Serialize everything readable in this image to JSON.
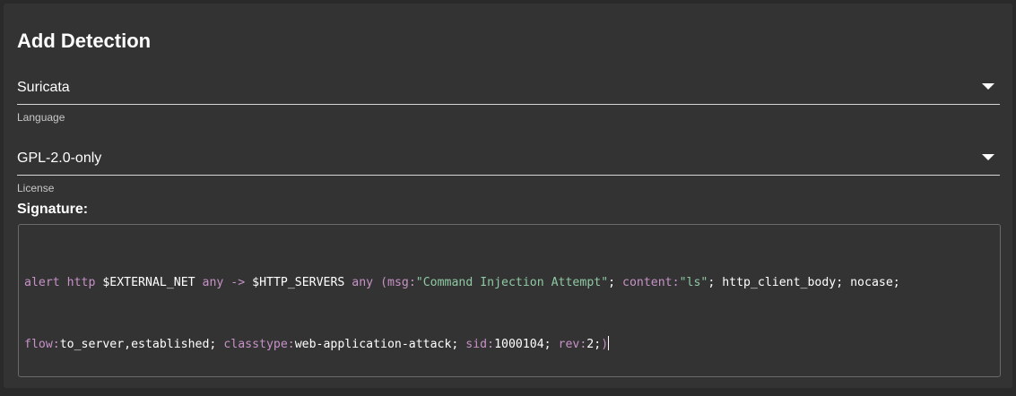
{
  "form": {
    "title": "Add Detection",
    "language": {
      "value": "Suricata",
      "helper": "Language"
    },
    "license": {
      "value": "GPL-2.0-only",
      "helper": "License"
    },
    "signature_label": "Signature:"
  },
  "signature": {
    "line1": [
      {
        "t": "kw",
        "text": "alert"
      },
      {
        "t": "plain",
        "text": " "
      },
      {
        "t": "kw",
        "text": "http"
      },
      {
        "t": "plain",
        "text": " $EXTERNAL_NET "
      },
      {
        "t": "kw",
        "text": "any"
      },
      {
        "t": "plain",
        "text": " "
      },
      {
        "t": "op",
        "text": "->"
      },
      {
        "t": "plain",
        "text": " $HTTP_SERVERS "
      },
      {
        "t": "kw",
        "text": "any"
      },
      {
        "t": "plain",
        "text": " "
      },
      {
        "t": "kw",
        "text": "(msg:"
      },
      {
        "t": "str",
        "text": "\"Command Injection Attempt\""
      },
      {
        "t": "plain",
        "text": "; "
      },
      {
        "t": "kw",
        "text": "content:"
      },
      {
        "t": "str",
        "text": "\"ls\""
      },
      {
        "t": "plain",
        "text": "; http_client_body; nocase;"
      }
    ],
    "line2": [
      {
        "t": "kw",
        "text": "flow:"
      },
      {
        "t": "plain",
        "text": "to_server,established; "
      },
      {
        "t": "kw",
        "text": "classtype:"
      },
      {
        "t": "plain",
        "text": "web-application-attack; "
      },
      {
        "t": "kw",
        "text": "sid:"
      },
      {
        "t": "plain",
        "text": "1000104; "
      },
      {
        "t": "kw",
        "text": "rev:"
      },
      {
        "t": "plain",
        "text": "2;"
      },
      {
        "t": "kw",
        "text": ")"
      }
    ]
  },
  "colors": {
    "background": "#2a2a2a",
    "card": "#333333",
    "keyword": "#c792c7",
    "string": "#8fc9a3",
    "text": "#ffffff"
  }
}
